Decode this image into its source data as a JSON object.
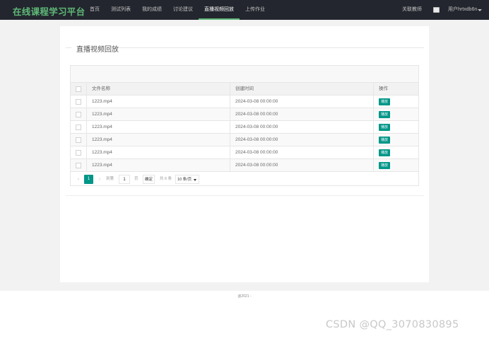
{
  "header": {
    "brand": "在线课程学习平台",
    "nav": [
      {
        "label": "首页",
        "active": false
      },
      {
        "label": "测试列表",
        "active": false
      },
      {
        "label": "我的成绩",
        "active": false
      },
      {
        "label": "讨论建议",
        "active": false
      },
      {
        "label": "直播视频回放",
        "active": true
      },
      {
        "label": "上传作业",
        "active": false
      }
    ],
    "about": "关联教师",
    "user": "用户hrtxdb6n"
  },
  "section": {
    "title": "直播视频回放"
  },
  "table": {
    "columns": [
      "文件名称",
      "创建时间",
      "操作"
    ],
    "rows": [
      {
        "name": "1223.mp4",
        "time": "2024-03-08 00:00:00",
        "action": "播放"
      },
      {
        "name": "1223.mp4",
        "time": "2024-03-08 00:00:00",
        "action": "播放"
      },
      {
        "name": "1223.mp4",
        "time": "2024-03-08 00:00:00",
        "action": "播放"
      },
      {
        "name": "1223.mp4",
        "time": "2024-03-08 00:00:00",
        "action": "播放"
      },
      {
        "name": "1223.mp4",
        "time": "2024-03-08 00:00:00",
        "action": "播放"
      },
      {
        "name": "1223.mp4",
        "time": "2024-03-08 00:00:00",
        "action": "播放"
      }
    ]
  },
  "pagination": {
    "prev": "‹",
    "current": "1",
    "next": "›",
    "goto_label": "到第",
    "page_input": "1",
    "page_unit": "页",
    "confirm": "确定",
    "total": "共 6 条",
    "page_size": "10 条/页"
  },
  "footer": "@2021 -",
  "watermark": "CSDN @QQ_3070830895",
  "colors": {
    "accent": "#009688",
    "brand": "#5fb878",
    "topbar": "#23262e"
  }
}
